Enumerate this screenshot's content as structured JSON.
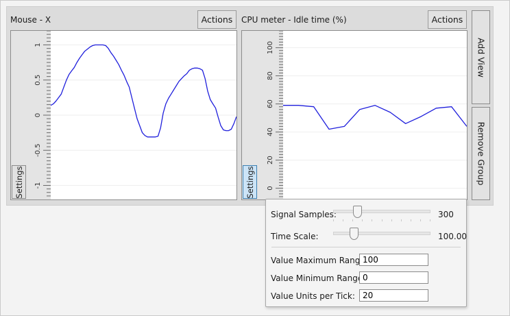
{
  "views": [
    {
      "title": "Mouse - X",
      "actions_label": "Actions",
      "settings_label": "Settings",
      "axis_ticks": [
        "1",
        "0.5",
        "0",
        "-0.5",
        "-1"
      ],
      "signal": {
        "type": "line",
        "ylim": [
          -1.2,
          1.2
        ],
        "color": "#1f1fdc",
        "y": [
          0.14,
          0.16,
          0.2,
          0.25,
          0.3,
          0.4,
          0.5,
          0.58,
          0.63,
          0.68,
          0.75,
          0.81,
          0.86,
          0.91,
          0.94,
          0.97,
          0.99,
          1.0,
          1.0,
          1.0,
          1.0,
          0.99,
          0.95,
          0.89,
          0.84,
          0.78,
          0.72,
          0.64,
          0.57,
          0.48,
          0.4,
          0.25,
          0.1,
          -0.05,
          -0.15,
          -0.25,
          -0.29,
          -0.31,
          -0.31,
          -0.31,
          -0.31,
          -0.3,
          -0.18,
          0.03,
          0.16,
          0.24,
          0.3,
          0.36,
          0.42,
          0.48,
          0.52,
          0.56,
          0.59,
          0.64,
          0.66,
          0.67,
          0.67,
          0.66,
          0.64,
          0.52,
          0.34,
          0.22,
          0.16,
          0.1,
          -0.03,
          -0.15,
          -0.21,
          -0.22,
          -0.22,
          -0.2,
          -0.12,
          -0.02
        ]
      }
    },
    {
      "title": "CPU meter - Idle time (%)",
      "actions_label": "Actions",
      "settings_label": "Settings",
      "axis_ticks": [
        "100",
        "80",
        "60",
        "40",
        "20",
        "0"
      ],
      "signal": {
        "type": "line",
        "ylim": [
          -8,
          112
        ],
        "color": "#1f1fdc",
        "y": [
          59,
          59,
          58,
          42,
          44,
          56,
          59,
          54,
          46,
          51,
          57,
          58,
          44
        ]
      }
    }
  ],
  "side_buttons": {
    "add_view": "Add View",
    "remove_group": "Remove Group"
  },
  "settings_popup": {
    "signal_samples_label": "Signal Samples:",
    "signal_samples_value": "300",
    "signal_samples_fraction": 0.22,
    "time_scale_label": "Time Scale:",
    "time_scale_value": "100.00",
    "time_scale_fraction": 0.18,
    "max_range_label": "Value Maximum Range:",
    "max_range_value": "100",
    "min_range_label": "Value Minimum Range:",
    "min_range_value": "0",
    "units_per_tick_label": "Value Units per Tick:",
    "units_per_tick_value": "20"
  }
}
